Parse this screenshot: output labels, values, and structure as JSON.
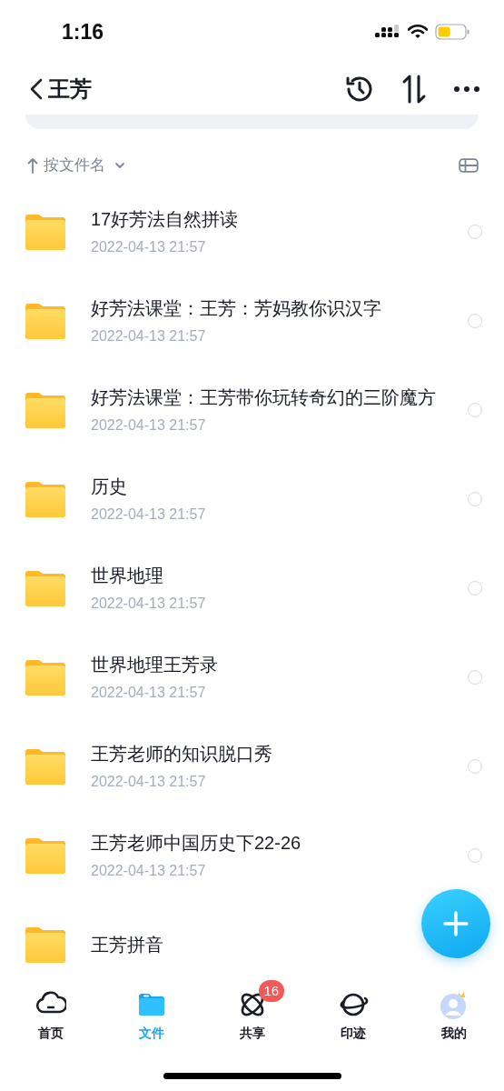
{
  "status_bar": {
    "time": "1:16"
  },
  "header": {
    "title": "王芳"
  },
  "sort": {
    "label": "按文件名"
  },
  "files": [
    {
      "name": "17好芳法自然拼读",
      "date": "2022-04-13 21:57",
      "selected": false
    },
    {
      "name": "好芳法课堂：王芳：芳妈教你识汉字",
      "date": "2022-04-13 21:57",
      "selected": false
    },
    {
      "name": "好芳法课堂：王芳带你玩转奇幻的三阶魔方",
      "date": "2022-04-13 21:57",
      "selected": false
    },
    {
      "name": "历史",
      "date": "2022-04-13 21:57",
      "selected": false
    },
    {
      "name": "世界地理",
      "date": "2022-04-13 21:57",
      "selected": false
    },
    {
      "name": "世界地理王芳录",
      "date": "2022-04-13 21:57",
      "selected": false
    },
    {
      "name": "王芳老师的知识脱口秀",
      "date": "2022-04-13 21:57",
      "selected": false
    },
    {
      "name": "王芳老师中国历史下22-26",
      "date": "2022-04-13 21:57",
      "selected": false
    },
    {
      "name": "王芳拼音",
      "selected": false
    }
  ],
  "tabs": [
    {
      "kind": "home",
      "label": "首页",
      "selected": false
    },
    {
      "kind": "files",
      "label": "文件",
      "selected": true
    },
    {
      "kind": "share",
      "label": "共享",
      "selected": false,
      "badge": "16"
    },
    {
      "kind": "planet",
      "label": "印迹",
      "selected": false
    },
    {
      "kind": "profile",
      "label": "我的",
      "selected": false
    }
  ]
}
